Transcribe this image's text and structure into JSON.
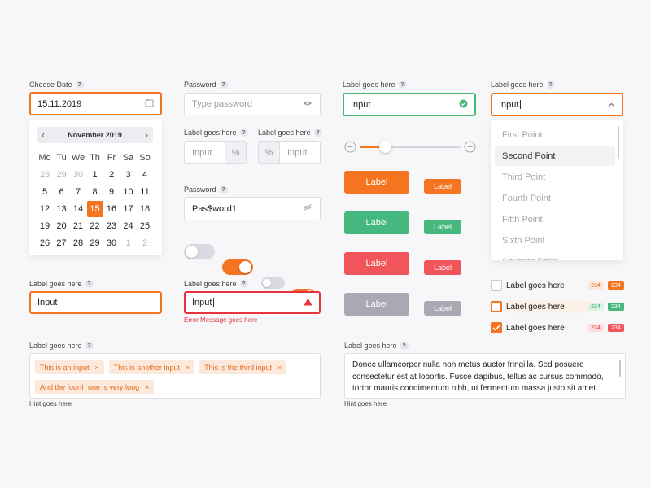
{
  "colors": {
    "orange": "#f47420",
    "green": "#45b872",
    "red": "#f2545b",
    "gray": "#a9a9b3"
  },
  "datepicker": {
    "label": "Choose Date",
    "value": "15.11.2019",
    "month_title": "November 2019",
    "weekdays": [
      "Mo",
      "Tu",
      "We",
      "Th",
      "Fr",
      "Sa",
      "So"
    ],
    "weeks": [
      [
        "28",
        "29",
        "30",
        "1",
        "2",
        "3",
        "4"
      ],
      [
        "5",
        "6",
        "7",
        "8",
        "9",
        "10",
        "11"
      ],
      [
        "12",
        "13",
        "14",
        "15",
        "16",
        "17",
        "18"
      ],
      [
        "19",
        "20",
        "21",
        "22",
        "23",
        "24",
        "25"
      ],
      [
        "26",
        "27",
        "28",
        "29",
        "30",
        "1",
        "2"
      ]
    ],
    "selected_day": "15"
  },
  "password1": {
    "label": "Password",
    "placeholder": "Type password"
  },
  "percent_left": {
    "label": "Label goes here",
    "placeholder": "Input",
    "unit": "%"
  },
  "percent_right": {
    "label": "Label goes here",
    "placeholder": "Input",
    "unit": "%"
  },
  "password2": {
    "label": "Password",
    "value": "Pas$word1"
  },
  "input_valid": {
    "label": "Label goes here",
    "value": "Input"
  },
  "slider": {
    "value_fraction": 0.25
  },
  "buttons": {
    "orange_large": "Label",
    "orange_small": "Label",
    "green_large": "Label",
    "green_small": "Label",
    "red_large": "Label",
    "red_small": "Label",
    "gray_large": "Label",
    "gray_small": "Label"
  },
  "select": {
    "label": "Label goes here",
    "value": "Input",
    "options": [
      "First Point",
      "Second Point",
      "Third Point",
      "Fourth Point",
      "Fifth Point",
      "Sixth Point",
      "Seventh Point"
    ],
    "highlighted": "Second Point"
  },
  "toggles": [
    true,
    false,
    true
  ],
  "input_focused": {
    "label": "Label goes here",
    "value": "Input"
  },
  "input_error": {
    "label": "Label goes here",
    "value": "Input",
    "error": "Error Message goes here"
  },
  "checkboxes": [
    {
      "label": "Label goes here",
      "checked": false,
      "badge_light": "234",
      "badge_dark": "234"
    },
    {
      "label": "Label goes here",
      "checked": false,
      "badge_light": "234",
      "badge_dark": "234"
    },
    {
      "label": "Label goes here",
      "checked": true,
      "badge_light": "234",
      "badge_dark": "234"
    }
  ],
  "tags_input": {
    "label": "Label goes here",
    "tags": [
      "This is an input",
      "This is another input",
      "This is the third input",
      "And the fourth one is very long"
    ],
    "hint": "Hint goes here"
  },
  "textarea": {
    "label": "Label goes here",
    "value": "Donec ullamcorper nulla non metus auctor fringilla. Sed posuere consectetur est at lobortis. Fusce dapibus, tellus ac cursus commodo, tortor mauris condimentum nibh, ut fermentum massa justo sit amet",
    "hint": "Hint goes here"
  }
}
